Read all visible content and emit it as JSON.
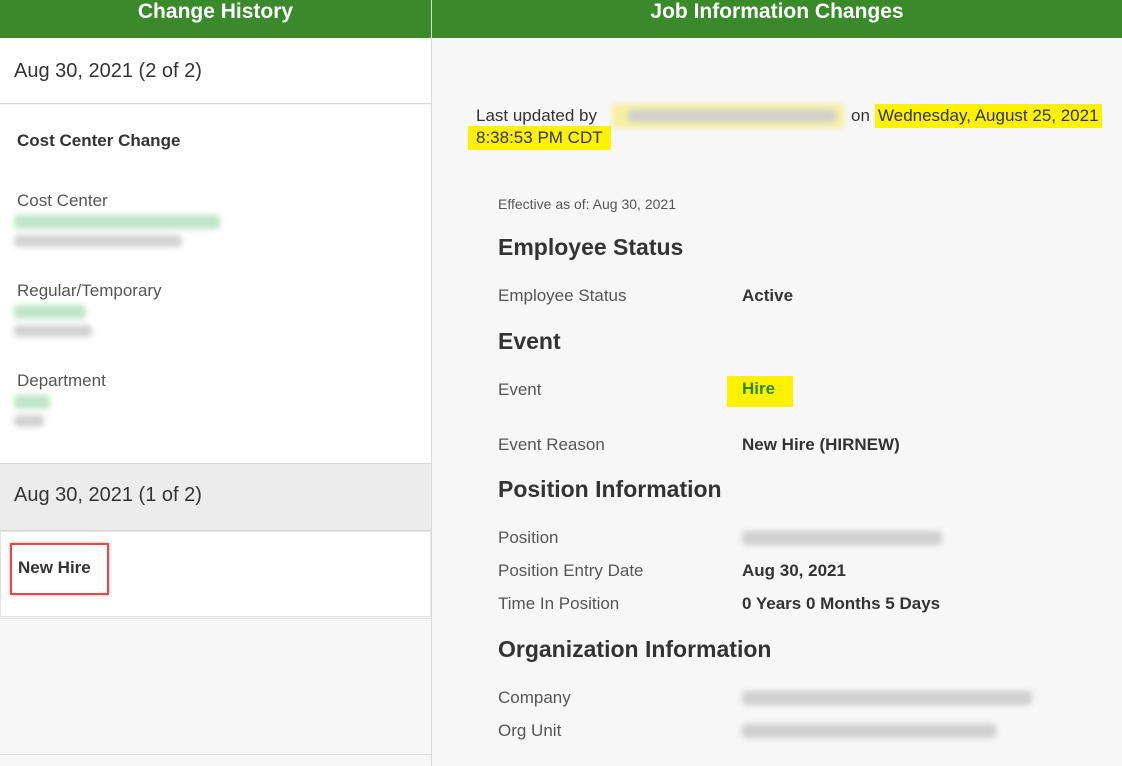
{
  "left_panel": {
    "header": "Change History",
    "entries": [
      {
        "date_label": "Aug 30, 2021 (2 of 2)",
        "change_title": "Cost Center Change",
        "fields": [
          {
            "label": "Cost Center"
          },
          {
            "label": "Regular/Temporary"
          },
          {
            "label": "Department"
          }
        ]
      },
      {
        "date_label": "Aug 30, 2021 (1 of 2)",
        "change_title": "New Hire"
      }
    ]
  },
  "right_panel": {
    "header": "Job Information Changes",
    "last_updated_prefix": "Last updated by",
    "last_updated_on": "on",
    "last_updated_datetime_1": "Wednesday, August 25, 2021",
    "last_updated_datetime_2": "8:38:53 PM CDT",
    "effective": "Effective as of: Aug 30, 2021",
    "sections": {
      "employee_status": {
        "title": "Employee Status",
        "rows": [
          {
            "label": "Employee Status",
            "value": "Active"
          }
        ]
      },
      "event": {
        "title": "Event",
        "rows": [
          {
            "label": "Event",
            "value": "Hire"
          },
          {
            "label": "Event Reason",
            "value": "New Hire (HIRNEW)"
          }
        ]
      },
      "position": {
        "title": "Position Information",
        "rows": [
          {
            "label": "Position"
          },
          {
            "label": "Position Entry Date",
            "value": "Aug 30, 2021"
          },
          {
            "label": "Time In Position",
            "value": "0 Years 0 Months 5 Days"
          }
        ]
      },
      "organization": {
        "title": "Organization Information",
        "rows": [
          {
            "label": "Company"
          },
          {
            "label": "Org Unit"
          }
        ]
      }
    }
  },
  "colors": {
    "header_green": "#3a8a2c",
    "highlight_yellow": "#fff200",
    "hire_green": "#2b8a1e",
    "annotation_red": "#e04a4a"
  }
}
